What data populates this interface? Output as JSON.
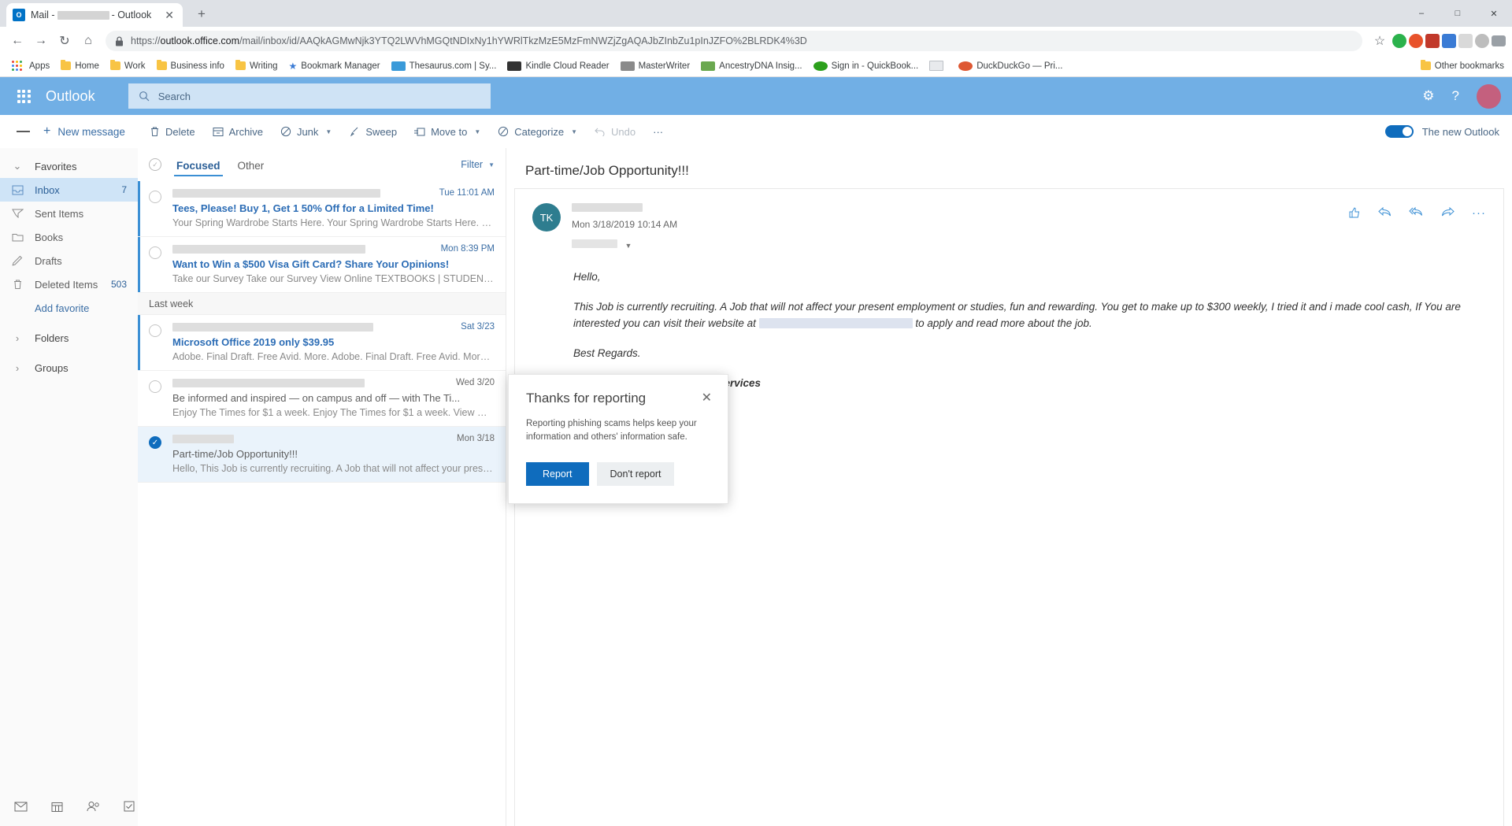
{
  "browser": {
    "tab": {
      "title_prefix": "Mail -",
      "title_suffix": "- Outlook",
      "favicon_label": "O"
    },
    "new_tab_label": "+",
    "window_controls": {
      "minimize": "–",
      "maximize": "□",
      "close": "✕"
    },
    "nav": {
      "back": "←",
      "forward": "→",
      "reload": "↻",
      "home": "⌂"
    },
    "omnibox": {
      "lock": "🔒",
      "scheme": "https://",
      "host": "outlook.office.com",
      "path": "/mail/inbox/id/AAQkAGMwNjk3YTQ2LWVhMGQtNDIxNy1hYWRlTkzMzE5MzFmNWZjZgAQAJbZInbZu1pInJZFO%2BLRDK4%3D",
      "star": "☆"
    },
    "bookmarks": [
      {
        "label": "Apps",
        "icon": "apps-grid-icon"
      },
      {
        "label": "Home",
        "icon": "folder-icon"
      },
      {
        "label": "Work",
        "icon": "folder-icon"
      },
      {
        "label": "Business info",
        "icon": "folder-icon"
      },
      {
        "label": "Writing",
        "icon": "folder-icon"
      },
      {
        "label": "Bookmark Manager",
        "icon": "star-icon"
      },
      {
        "label": "Thesaurus.com | Sy...",
        "icon": "site-icon"
      },
      {
        "label": "Kindle Cloud Reader",
        "icon": "site-icon"
      },
      {
        "label": "MasterWriter",
        "icon": "site-icon"
      },
      {
        "label": "AncestryDNA Insig...",
        "icon": "site-icon"
      },
      {
        "label": "Sign in - QuickBook...",
        "icon": "site-icon"
      },
      {
        "label": "",
        "icon": "page-icon"
      },
      {
        "label": "DuckDuckGo — Pri...",
        "icon": "site-icon"
      }
    ],
    "other_bookmarks": "Other bookmarks"
  },
  "outlook": {
    "brand": "Outlook",
    "search": {
      "placeholder": "Search",
      "icon": "search-icon"
    },
    "header_icons": {
      "settings": "gear-icon",
      "help": "help-icon",
      "avatar": "avatar"
    },
    "commandbar": {
      "new_message": "New message",
      "items": [
        {
          "label": "Delete",
          "icon": "trash-icon",
          "chevron": false,
          "disabled": false
        },
        {
          "label": "Archive",
          "icon": "archive-icon",
          "chevron": false,
          "disabled": false
        },
        {
          "label": "Junk",
          "icon": "block-icon",
          "chevron": true,
          "disabled": false
        },
        {
          "label": "Sweep",
          "icon": "broom-icon",
          "chevron": false,
          "disabled": false
        },
        {
          "label": "Move to",
          "icon": "move-icon",
          "chevron": true,
          "disabled": false
        },
        {
          "label": "Categorize",
          "icon": "tag-icon",
          "chevron": true,
          "disabled": false
        },
        {
          "label": "Undo",
          "icon": "undo-icon",
          "chevron": false,
          "disabled": true
        },
        {
          "label": "···",
          "icon": "more-icon",
          "chevron": false,
          "disabled": false
        }
      ],
      "new_outlook_label": "The new Outlook",
      "toggle_on": true
    },
    "nav": {
      "favorites_label": "Favorites",
      "items": [
        {
          "label": "Inbox",
          "count": "7",
          "icon": "inbox-icon",
          "active": true
        },
        {
          "label": "Sent Items",
          "count": "",
          "icon": "send-icon",
          "active": false
        },
        {
          "label": "Books",
          "count": "",
          "icon": "folder-icon",
          "active": false
        },
        {
          "label": "Drafts",
          "count": "",
          "icon": "pencil-icon",
          "active": false
        },
        {
          "label": "Deleted Items",
          "count": "503",
          "icon": "trash-icon",
          "active": false
        }
      ],
      "add_favorite": "Add favorite",
      "folders_label": "Folders",
      "groups_label": "Groups",
      "bottom_icons": [
        "mail-icon",
        "calendar-icon",
        "people-icon",
        "tasks-icon"
      ]
    },
    "list": {
      "pivots": [
        {
          "label": "Focused",
          "selected": true
        },
        {
          "label": "Other",
          "selected": false
        }
      ],
      "filter_label": "Filter",
      "select_all_icon": "circle-check-icon",
      "group_header": "Last week",
      "messages": [
        {
          "subject": "Tees, Please! Buy 1, Get 1 50% Off for a Limited Time!",
          "preview": "Your Spring Wardrobe Starts Here. Your Spring Wardrobe Starts Here. View Onl...",
          "date": "Tue 11:01 AM",
          "unread": true,
          "selected": false,
          "sender_redacted_width": 264,
          "group": "recent"
        },
        {
          "subject": "Want to Win a $500 Visa Gift Card? Share Your Opinions!",
          "preview": "Take our Survey Take our Survey View Online TEXTBOOKS | STUDENT OFFERS | ...",
          "date": "Mon 8:39 PM",
          "unread": true,
          "selected": false,
          "sender_redacted_width": 245,
          "group": "recent"
        },
        {
          "subject": "Microsoft Office 2019 only $39.95",
          "preview": "Adobe. Final Draft. Free Avid. More. Adobe. Final Draft. Free Avid. More. View ...",
          "date": "Sat 3/23",
          "unread": true,
          "selected": false,
          "sender_redacted_width": 255,
          "group": "lastweek"
        },
        {
          "subject": "Be informed and inspired — on campus and off — with The Ti...",
          "preview": "Enjoy The Times for $1 a week. Enjoy The Times for $1 a week. View Online TEX...",
          "date": "Wed 3/20",
          "unread": false,
          "selected": false,
          "sender_redacted_width": 244,
          "group": "lastweek"
        },
        {
          "subject": "Part-time/Job Opportunity!!!",
          "preview": "Hello, This Job is currently recruiting. A Job that will not affect your present em...",
          "date": "Mon 3/18",
          "unread": false,
          "selected": true,
          "sender_redacted_width": 78,
          "group": "lastweek"
        }
      ]
    },
    "reading": {
      "title": "Part-time/Job Opportunity!!!",
      "avatar_initials": "TK",
      "date": "Mon 3/18/2019 10:14 AM",
      "actions": [
        "thumbs-up-icon",
        "reply-icon",
        "reply-all-icon",
        "forward-icon",
        "more-icon"
      ],
      "paragraphs": [
        "Hello,",
        "This Job is currently recruiting.  A Job that will not affect your present employment or studies, fun and rewarding.  You get to make up to $300 weekly, I tried it and i made cool cash, If You are interested you can visit their website at",
        "to apply and read more about the job.",
        "Best Regards."
      ],
      "signature": "Job Placement And Student Services"
    },
    "dialog": {
      "title": "Thanks for reporting",
      "body": "Reporting phishing scams helps keep your information and others' information safe.",
      "primary_button": "Report",
      "secondary_button": "Don't report",
      "close_icon": "close-icon"
    }
  },
  "colors": {
    "accent": "#0f6cbd",
    "header": "#71afe5",
    "link": "#3b6ea5",
    "selected_row": "#eaf3fb",
    "nav_active": "#cfe4f7"
  }
}
